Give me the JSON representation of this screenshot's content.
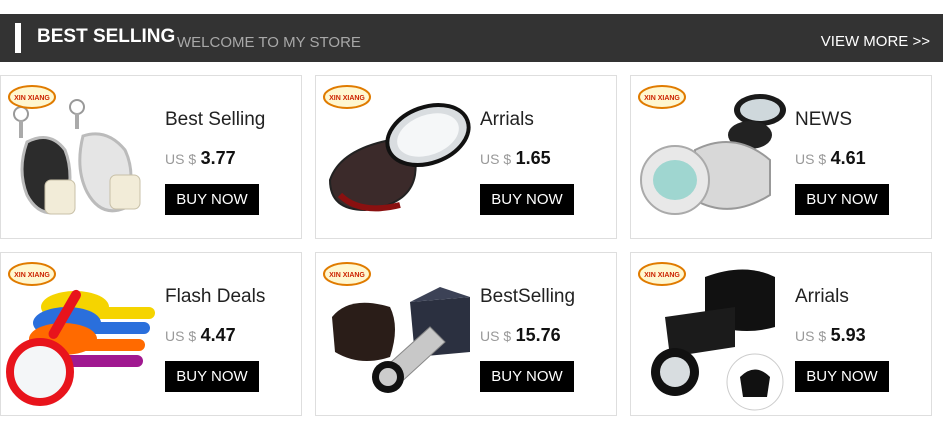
{
  "header": {
    "title": "BEST SELLING",
    "subtitle": "WELCOME TO MY STORE",
    "view_more": "VIEW MORE >>"
  },
  "brand_logo_text": "XIN XIANG",
  "products": [
    {
      "name": "Best Selling",
      "currency": "US $",
      "price": "3.77",
      "button": "BUY NOW",
      "image": "keychain-loupes"
    },
    {
      "name": "Arrials",
      "currency": "US $",
      "price": "1.65",
      "button": "BUY NOW",
      "image": "folding-pocket-magnifier"
    },
    {
      "name": "NEWS",
      "currency": "US $",
      "price": "4.61",
      "button": "BUY NOW",
      "image": "jeweler-loupe-silver"
    },
    {
      "name": "Flash Deals",
      "currency": "US $",
      "price": "4.47",
      "button": "BUY NOW",
      "image": "colorful-handheld-magnifiers"
    },
    {
      "name": "BestSelling",
      "currency": "US $",
      "price": "15.76",
      "button": "BUY NOW",
      "image": "loupe-with-case-and-box"
    },
    {
      "name": "Arrials",
      "currency": "US $",
      "price": "5.93",
      "button": "BUY NOW",
      "image": "black-loupe-with-pouch"
    }
  ],
  "colors": {
    "header_bg": "#333333",
    "button_bg": "#000000",
    "card_border": "#dedede",
    "logo_ring": "#e07b00"
  }
}
